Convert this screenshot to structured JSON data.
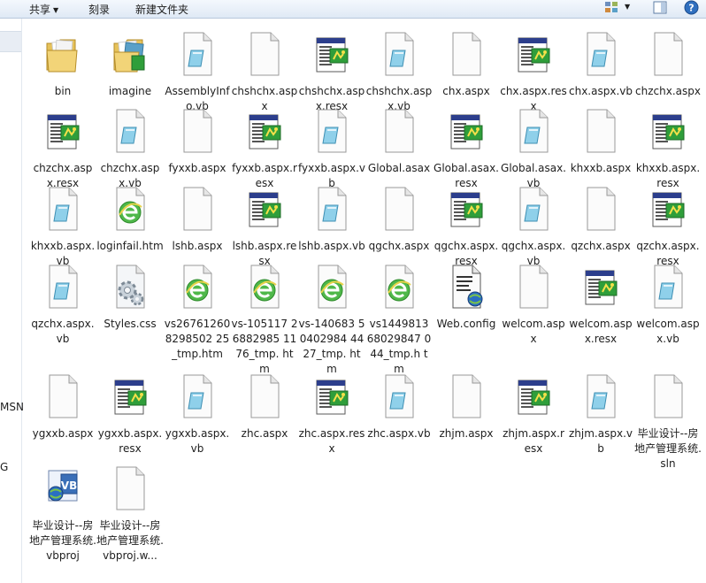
{
  "toolbar": {
    "share_label": "共享",
    "burn_label": "刻录",
    "new_folder_label": "新建文件夹"
  },
  "nav_pane": {
    "labels": [
      "MSN",
      "G"
    ]
  },
  "files": [
    {
      "name": "bin",
      "type": "folder"
    },
    {
      "name": "imagine",
      "type": "folder-images"
    },
    {
      "name": "AssemblyInfo.vb",
      "type": "vb"
    },
    {
      "name": "chshchx.aspx",
      "type": "blank"
    },
    {
      "name": "chshchx.aspx.resx",
      "type": "resx"
    },
    {
      "name": "chshchx.aspx.vb",
      "type": "vb"
    },
    {
      "name": "chx.aspx",
      "type": "blank"
    },
    {
      "name": "chx.aspx.resx",
      "type": "resx"
    },
    {
      "name": "chx.aspx.vb",
      "type": "vb"
    },
    {
      "name": "chzchx.aspx",
      "type": "blank"
    },
    {
      "name": "chzchx.aspx.resx",
      "type": "resx"
    },
    {
      "name": "chzchx.aspx.vb",
      "type": "vb"
    },
    {
      "name": "fyxxb.aspx",
      "type": "blank"
    },
    {
      "name": "fyxxb.aspx.resx",
      "type": "resx"
    },
    {
      "name": "fyxxb.aspx.vb",
      "type": "vb"
    },
    {
      "name": "Global.asax",
      "type": "blank"
    },
    {
      "name": "Global.asax.resx",
      "type": "resx"
    },
    {
      "name": "Global.asax.vb",
      "type": "vb"
    },
    {
      "name": "khxxb.aspx",
      "type": "blank"
    },
    {
      "name": "khxxb.aspx.resx",
      "type": "resx"
    },
    {
      "name": "khxxb.aspx.vb",
      "type": "vb"
    },
    {
      "name": "loginfail.htm",
      "type": "htm"
    },
    {
      "name": "lshb.aspx",
      "type": "blank"
    },
    {
      "name": "lshb.aspx.resx",
      "type": "resx"
    },
    {
      "name": "lshb.aspx.vb",
      "type": "vb"
    },
    {
      "name": "qgchx.aspx",
      "type": "blank"
    },
    {
      "name": "qgchx.aspx.resx",
      "type": "resx"
    },
    {
      "name": "qgchx.aspx.vb",
      "type": "vb"
    },
    {
      "name": "qzchx.aspx",
      "type": "blank"
    },
    {
      "name": "qzchx.aspx.resx",
      "type": "resx"
    },
    {
      "name": "qzchx.aspx.vb",
      "type": "vb"
    },
    {
      "name": "Styles.css",
      "type": "css"
    },
    {
      "name": "vs267612608298502 25_tmp.htm",
      "type": "htm"
    },
    {
      "name": "vs-105117 26882985 1176_tmp. htm",
      "type": "htm"
    },
    {
      "name": "vs-140683 50402984 4427_tmp. htm",
      "type": "htm"
    },
    {
      "name": "vs1449813 68029847 044_tmp.h tm",
      "type": "htm"
    },
    {
      "name": "Web.config",
      "type": "config"
    },
    {
      "name": "welcom.aspx",
      "type": "blank"
    },
    {
      "name": "welcom.aspx.resx",
      "type": "resx"
    },
    {
      "name": "welcom.aspx.vb",
      "type": "vb"
    },
    {
      "name": "ygxxb.aspx",
      "type": "blank"
    },
    {
      "name": "ygxxb.aspx.resx",
      "type": "resx"
    },
    {
      "name": "ygxxb.aspx.vb",
      "type": "vb"
    },
    {
      "name": "zhc.aspx",
      "type": "blank"
    },
    {
      "name": "zhc.aspx.resx",
      "type": "resx"
    },
    {
      "name": "zhc.aspx.vb",
      "type": "vb"
    },
    {
      "name": "zhjm.aspx",
      "type": "blank"
    },
    {
      "name": "zhjm.aspx.resx",
      "type": "resx"
    },
    {
      "name": "zhjm.aspx.vb",
      "type": "vb"
    },
    {
      "name": "毕业设计--房地产管理系统.sln",
      "type": "blank"
    },
    {
      "name": "毕业设计--房地产管理系统.vbproj",
      "type": "vbproj"
    },
    {
      "name": "毕业设计--房地产管理系统.vbproj.w...",
      "type": "blank"
    }
  ]
}
